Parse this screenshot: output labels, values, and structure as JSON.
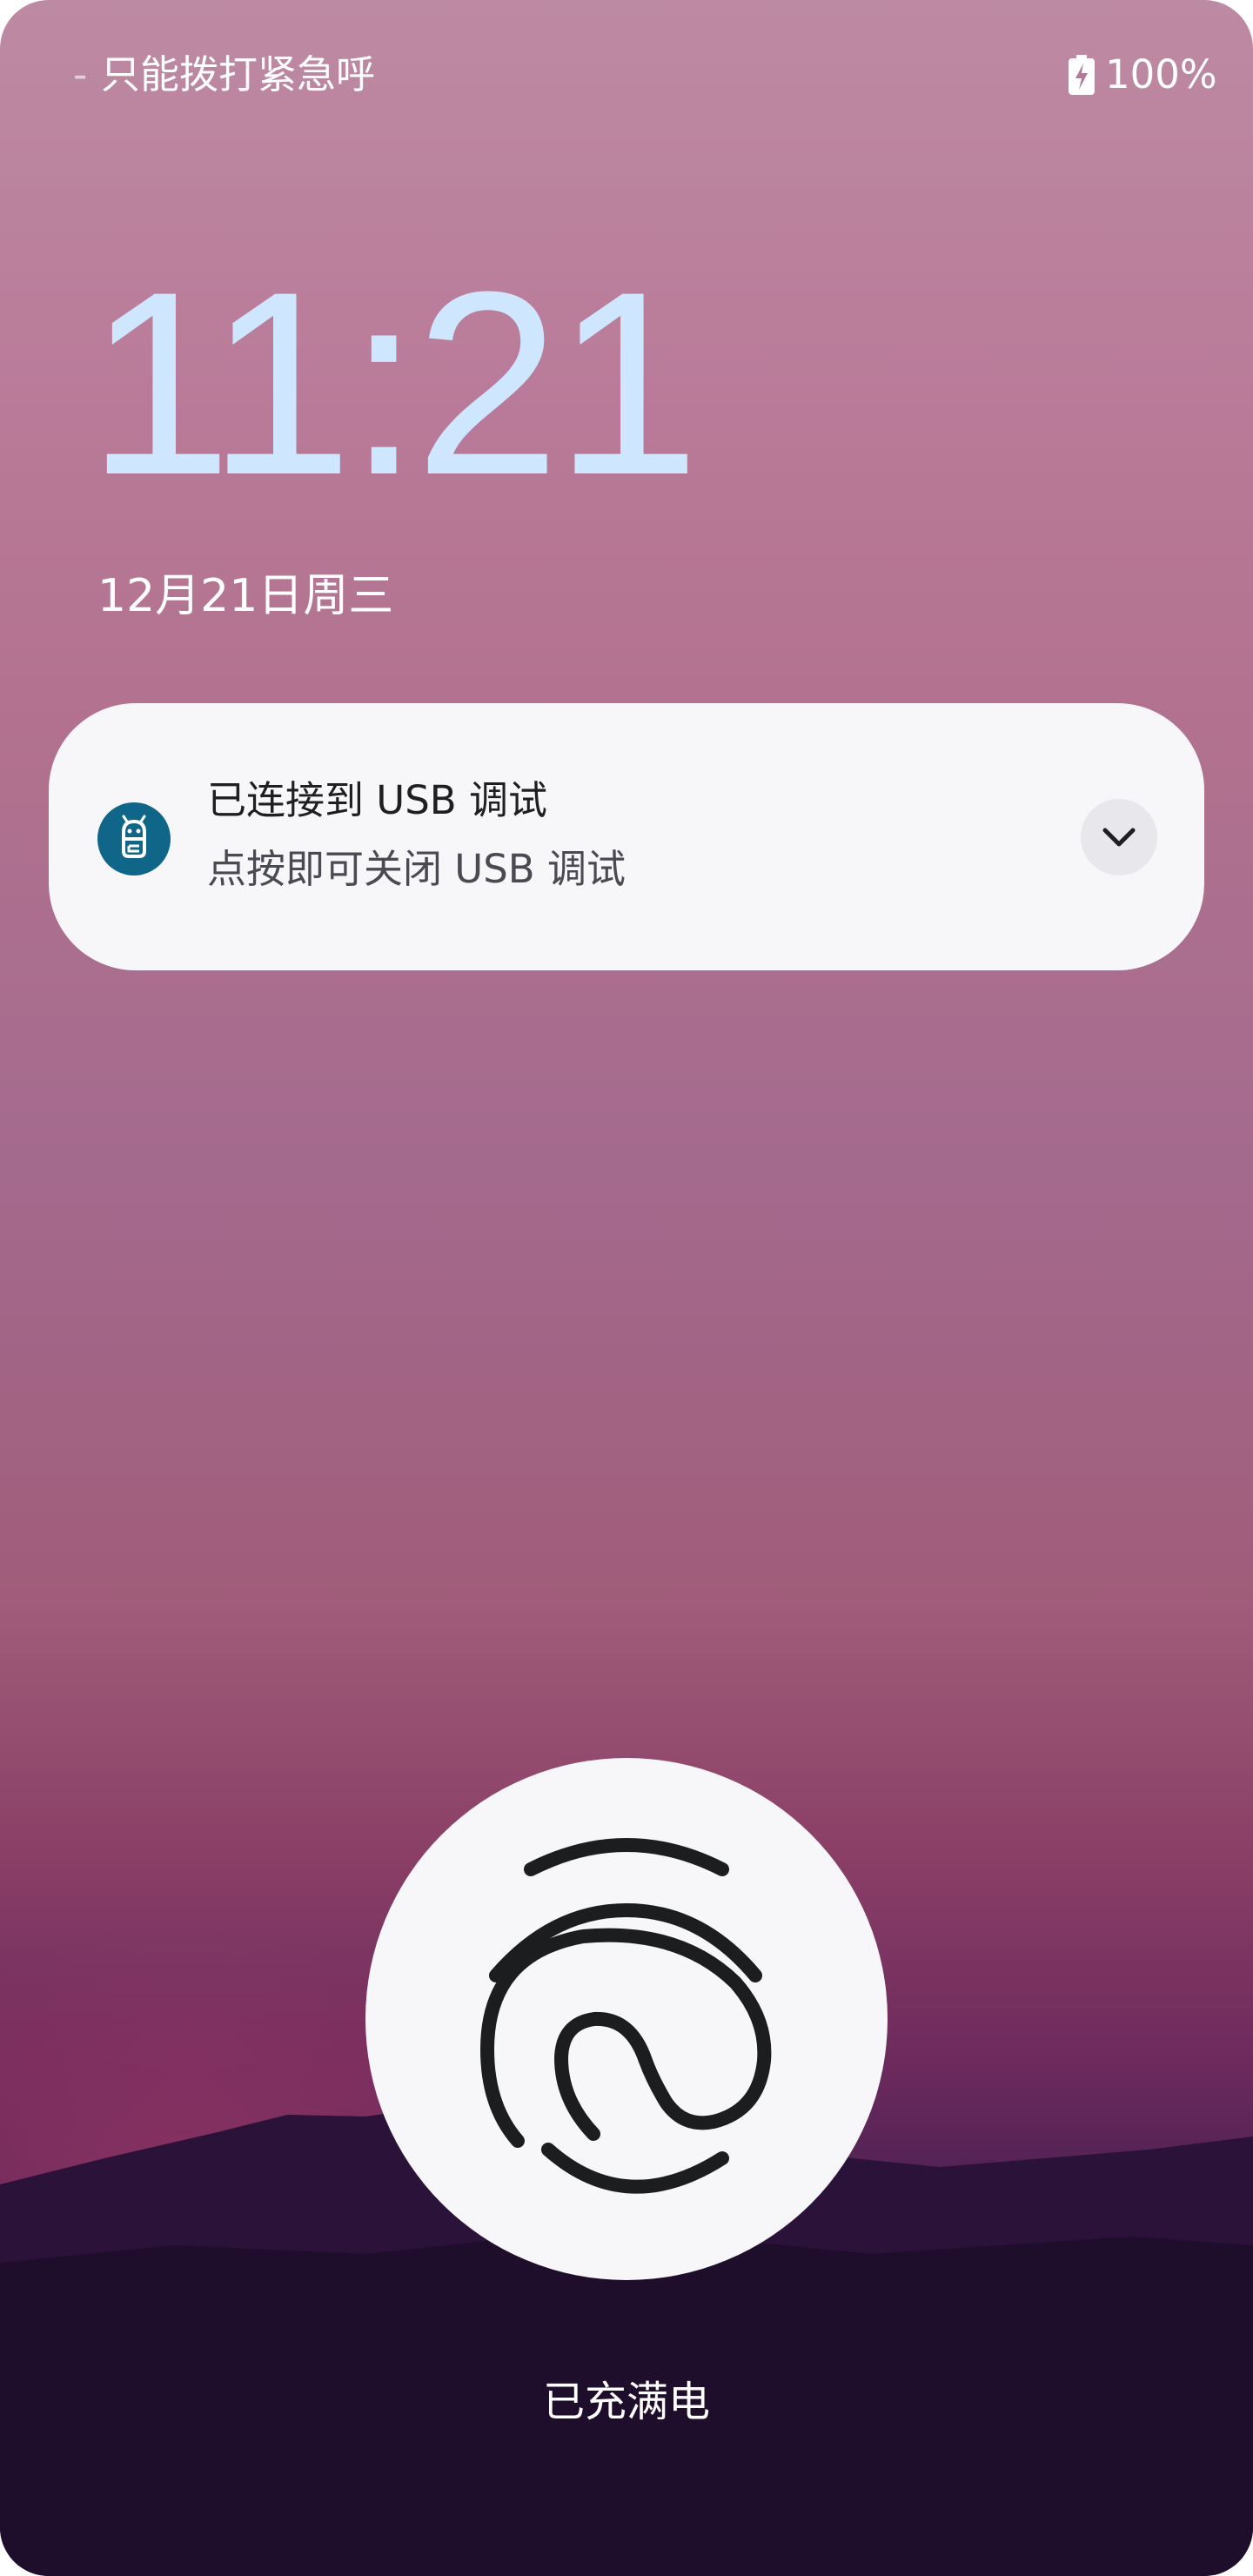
{
  "status_bar": {
    "carrier_text": "只能拨打紧急呼",
    "battery_percent": "100%",
    "battery_icon": "battery-charging-icon"
  },
  "lockscreen": {
    "time": "11:21",
    "date": "12月21日周三",
    "charging_status": "已充满电"
  },
  "notification": {
    "title": "已连接到 USB 调试",
    "body": "点按即可关闭 USB 调试",
    "icon": "android-debug-icon",
    "icon_color": "#0f6688",
    "expand_icon": "chevron-down-icon"
  },
  "fingerprint": {
    "icon": "fingerprint-icon"
  },
  "colors": {
    "clock": "#cfe6ff",
    "card_background": "#f7f7fa"
  }
}
